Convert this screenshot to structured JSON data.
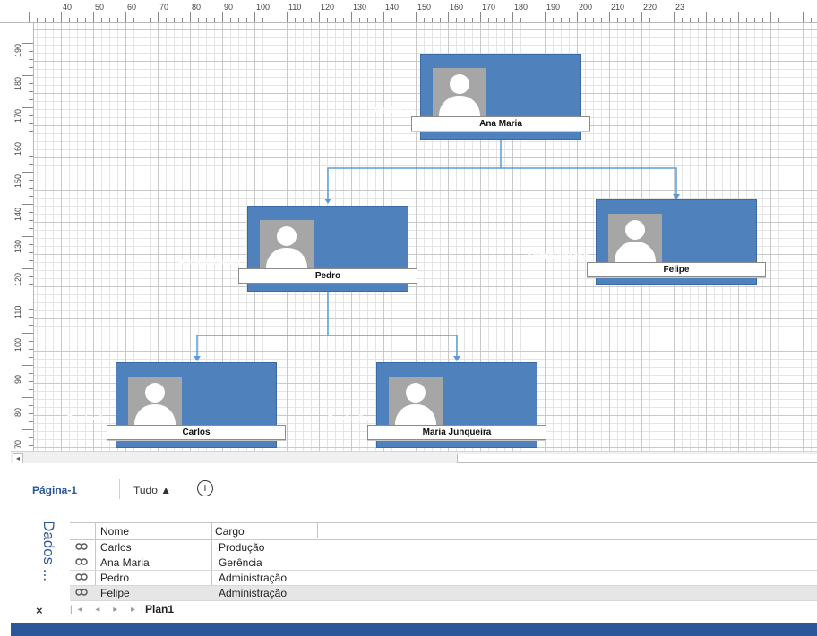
{
  "ruler": {
    "horizontal": [
      "40",
      "50",
      "60",
      "70",
      "80",
      "90",
      "100",
      "110",
      "120",
      "130",
      "140",
      "150",
      "160",
      "170",
      "180",
      "190",
      "200",
      "210",
      "220",
      "23"
    ],
    "vertical": [
      "190",
      "180",
      "170",
      "160",
      "150",
      "140",
      "130",
      "120",
      "110",
      "100",
      "90",
      "80",
      "70"
    ]
  },
  "org_chart": {
    "nodes": [
      {
        "id": "ana",
        "name": "Ana Maria",
        "role": "Gerência"
      },
      {
        "id": "pedro",
        "name": "Pedro",
        "role": "Administração"
      },
      {
        "id": "felipe",
        "name": "Felipe",
        "role": "Administração"
      },
      {
        "id": "carlos",
        "name": "Carlos",
        "role": "Produção"
      },
      {
        "id": "maria",
        "name": "Maria Junqueira",
        "role": "Produção"
      }
    ],
    "colors": {
      "box": "#4f81bd",
      "connector": "#5b9bd5",
      "photo": "#a6a6a6"
    }
  },
  "page_tabs": {
    "current": "Página-1",
    "all": "Tudo ▲",
    "add_icon": "add-page-icon"
  },
  "data_panel": {
    "title": "Dados ...",
    "columns": [
      "Nome",
      "Cargo"
    ],
    "rows": [
      {
        "name": "Carlos",
        "cargo": "Produção"
      },
      {
        "name": "Ana Maria",
        "cargo": "Gerência"
      },
      {
        "name": "Pedro",
        "cargo": "Administração"
      },
      {
        "name": "Felipe",
        "cargo": "Administração"
      }
    ],
    "sheet_nav": "|◂ ◂ ▸ ▸|",
    "sheet_tab": "Plan1",
    "close": "×"
  },
  "accent_color": "#2b579a"
}
